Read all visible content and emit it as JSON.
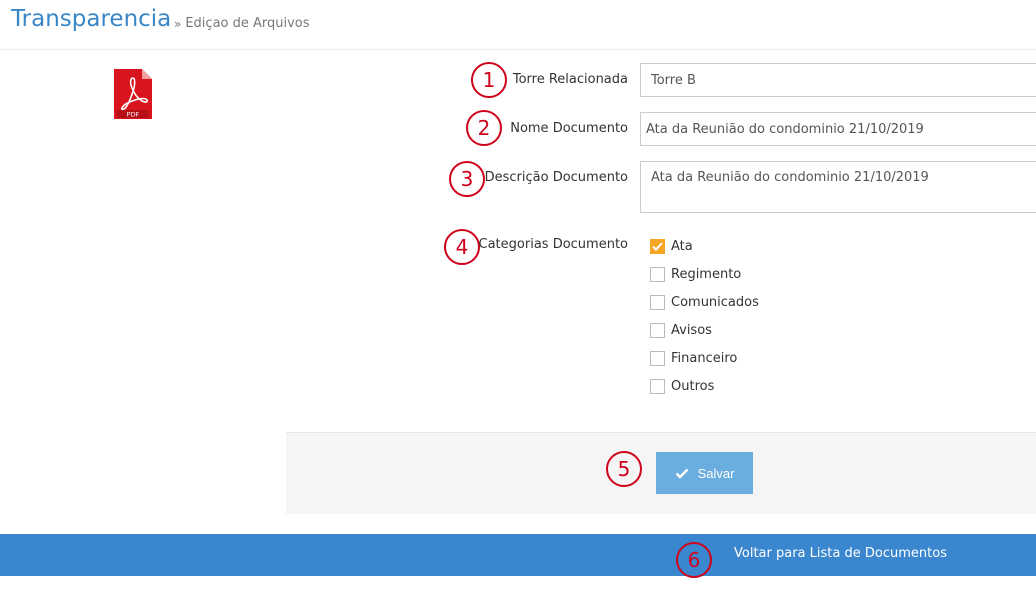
{
  "header": {
    "title": "Transparencia",
    "breadcrumb": "Ediçao de Arquivos"
  },
  "file_icon": {
    "name": "pdf-icon",
    "label": "PDF"
  },
  "form": {
    "torre": {
      "label": "Torre Relacionada",
      "value": "Torre B",
      "step": "1"
    },
    "nome": {
      "label": "Nome Documento",
      "value": "Ata da Reunião do condominio 21/10/2019",
      "step": "2"
    },
    "descricao": {
      "label": "Descrição Documento",
      "value": "Ata da Reunião do condominio 21/10/2019",
      "step": "3"
    },
    "categorias": {
      "label": "Categorias Documento",
      "step": "4",
      "options": [
        {
          "label": "Ata",
          "checked": true
        },
        {
          "label": "Regimento",
          "checked": false
        },
        {
          "label": "Comunicados",
          "checked": false
        },
        {
          "label": "Avisos",
          "checked": false
        },
        {
          "label": "Financeiro",
          "checked": false
        },
        {
          "label": "Outros",
          "checked": false
        }
      ]
    }
  },
  "actions": {
    "save_label": "Salvar",
    "save_step": "5",
    "back_label": "Voltar para Lista de Documentos",
    "back_step": "6"
  },
  "colors": {
    "accent": "#3a87c8",
    "checkbox_checked": "#f5a623",
    "annotation": "#d0021b",
    "save_button": "#6aaee0",
    "bottom_bar": "#3a87d0"
  }
}
